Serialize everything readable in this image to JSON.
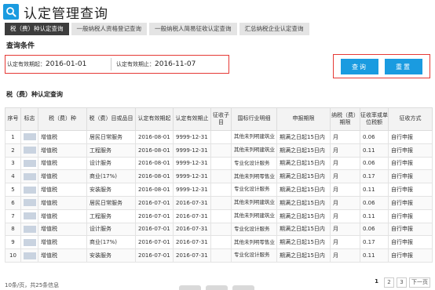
{
  "header": {
    "title": "认定管理查询"
  },
  "tabs": [
    {
      "label": "税（费）种认定查询",
      "active": true
    },
    {
      "label": "一般纳税人资格登记查询",
      "active": false
    },
    {
      "label": "一般纳税人简易征收认定查询",
      "active": false
    },
    {
      "label": "汇总纳税企业认定查询",
      "active": false
    }
  ],
  "conditions": {
    "title": "查询条件",
    "start_label": "认定有效期起：",
    "start_value": "2016-01-01",
    "end_label": "认定有效期止：",
    "end_value": "2016-11-07",
    "query_button": "查询",
    "reset_button": "重置"
  },
  "results": {
    "title": "税（费）种认定查询",
    "columns": [
      "序号",
      "标志",
      "税（费）种",
      "税（费）目或品目",
      "认定有效期起",
      "认定有效期止",
      "征收子目",
      "国标行业明细",
      "申报期限",
      "纳税（费）期限",
      "征收率或单位税额",
      "征收方式"
    ],
    "rows": [
      [
        "1",
        "",
        "增值税",
        "居民日常服务",
        "2016-08-01",
        "9999-12-31",
        "",
        "其他未列明建筑业",
        "期满之日起15日内",
        "月",
        "0.06",
        "自行申报"
      ],
      [
        "2",
        "",
        "增值税",
        "工程服务",
        "2016-08-01",
        "9999-12-31",
        "",
        "其他未列明建筑业",
        "期满之日起15日内",
        "月",
        "0.11",
        "自行申报"
      ],
      [
        "3",
        "",
        "增值税",
        "设计服务",
        "2016-08-01",
        "9999-12-31",
        "",
        "专业化设计服务",
        "期满之日起15日内",
        "月",
        "0.06",
        "自行申报"
      ],
      [
        "4",
        "",
        "增值税",
        "商业(17%)",
        "2016-08-01",
        "9999-12-31",
        "",
        "其他未列明零售业",
        "期满之日起15日内",
        "月",
        "0.17",
        "自行申报"
      ],
      [
        "5",
        "",
        "增值税",
        "安装服务",
        "2016-08-01",
        "9999-12-31",
        "",
        "专业化设计服务",
        "期满之日起15日内",
        "月",
        "0.11",
        "自行申报"
      ],
      [
        "6",
        "",
        "增值税",
        "居民日常服务",
        "2016-07-01",
        "2016-07-31",
        "",
        "其他未列明建筑业",
        "期满之日起15日内",
        "月",
        "0.06",
        "自行申报"
      ],
      [
        "7",
        "",
        "增值税",
        "工程服务",
        "2016-07-01",
        "2016-07-31",
        "",
        "其他未列明建筑业",
        "期满之日起15日内",
        "月",
        "0.11",
        "自行申报"
      ],
      [
        "8",
        "",
        "增值税",
        "设计服务",
        "2016-07-01",
        "2016-07-31",
        "",
        "专业化设计服务",
        "期满之日起15日内",
        "月",
        "0.06",
        "自行申报"
      ],
      [
        "9",
        "",
        "增值税",
        "商业(17%)",
        "2016-07-01",
        "2016-07-31",
        "",
        "其他未列明零售业",
        "期满之日起15日内",
        "月",
        "0.17",
        "自行申报"
      ],
      [
        "10",
        "",
        "增值税",
        "安装服务",
        "2016-07-01",
        "2016-07-31",
        "",
        "专业化设计服务",
        "期满之日起15日内",
        "月",
        "0.11",
        "自行申报"
      ]
    ]
  },
  "pagination": {
    "summary": "10条/页，共25条信息",
    "pages": [
      "1",
      "2",
      "3"
    ],
    "current": "1",
    "next": "下一页"
  },
  "colors": {
    "accent": "#1a9be0",
    "highlight_border": "#e53935",
    "active_tab": "#3d3d3d"
  },
  "icons": {
    "logo": "search-icon"
  }
}
